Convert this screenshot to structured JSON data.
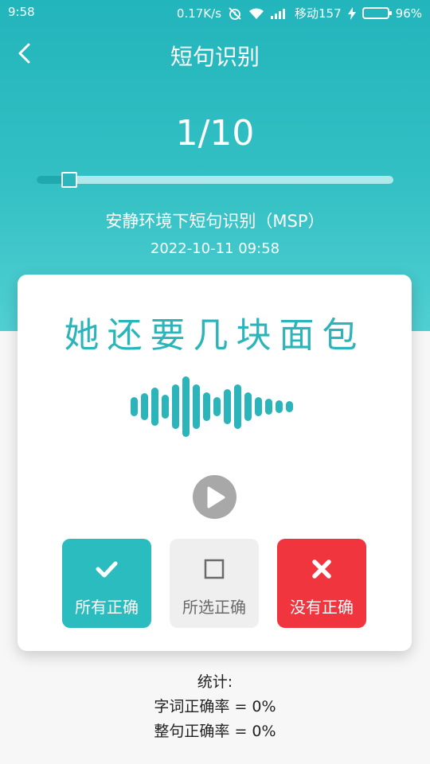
{
  "status_bar": {
    "time": "9:58",
    "network_speed": "0.17K/s",
    "carrier": "移动157",
    "battery": "96%",
    "icons": [
      "alarm-off-icon",
      "wifi-icon",
      "signal-icon",
      "charging-icon",
      "battery-icon"
    ]
  },
  "header": {
    "back_icon": "chevron-left-icon",
    "title": "短句识别"
  },
  "progress": {
    "text": "1/10",
    "current": 1,
    "total": 10
  },
  "scenario": "安静环境下短句识别（MSP）",
  "timestamp": "2022-10-11 09:58",
  "card": {
    "sentence": "她还要几块面包",
    "waveform_icon": "sound-wave-icon",
    "play_icon": "play-icon"
  },
  "actions": {
    "all_correct": "所有正确",
    "selected_correct": "所选正确",
    "none_correct": "没有正确"
  },
  "stats": {
    "title": "统计:",
    "word_accuracy": "字词正确率 = 0%",
    "sentence_accuracy": "整句正确率 = 0%"
  },
  "colors": {
    "accent": "#2bb8bd",
    "danger": "#f1353f",
    "neutral": "#efefef"
  }
}
